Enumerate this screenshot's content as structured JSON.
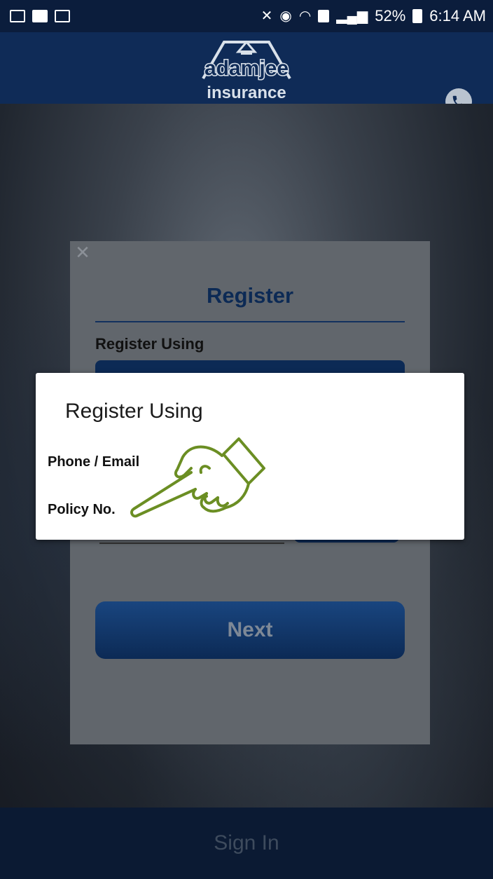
{
  "status_bar": {
    "battery": "52%",
    "time": "6:14 AM",
    "icons": [
      "gallery-icon",
      "video-icon",
      "translate-icon",
      "mute-icon",
      "alarm-icon",
      "wifi-icon",
      "sim-icon",
      "signal-icon",
      "battery-icon"
    ]
  },
  "header": {
    "logo_line1": "adamjee",
    "logo_line2": "insurance",
    "phone_icon": "phone-icon"
  },
  "register_form": {
    "title": "Register",
    "register_using_label": "Register Using",
    "next_label": "Next"
  },
  "dialog": {
    "title": "Register Using",
    "options": [
      "Phone / Email",
      "Policy No."
    ]
  },
  "bottom": {
    "signin_label": "Sign In"
  },
  "colors": {
    "header_bg": "#0f2b57",
    "accent": "#0c2a55",
    "pointer_hand": "#6b8e23"
  }
}
